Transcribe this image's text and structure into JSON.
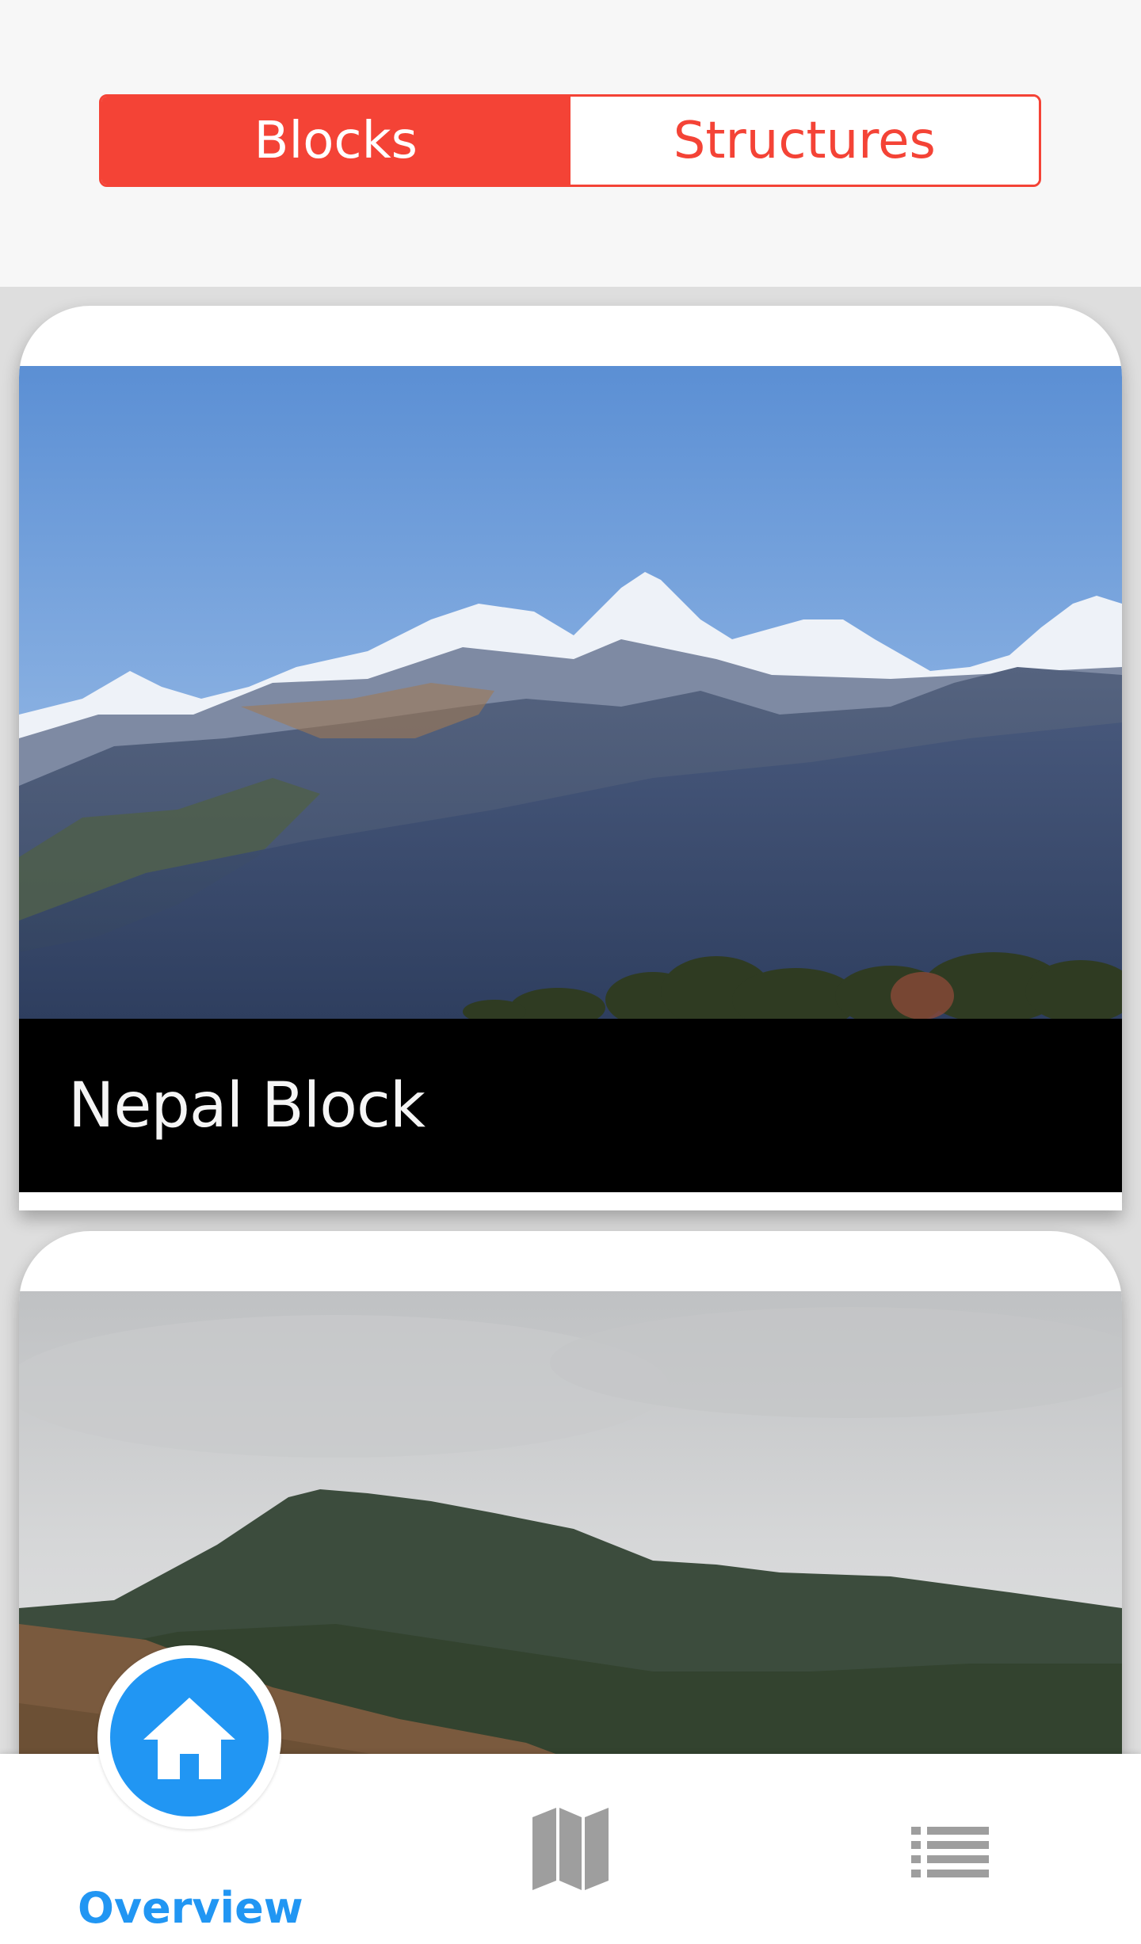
{
  "header": {
    "tabs": [
      {
        "label": "Blocks",
        "active": true
      },
      {
        "label": "Structures",
        "active": false
      }
    ],
    "accent_color": "#f44336"
  },
  "cards": [
    {
      "title": "Nepal Block",
      "image": "snow-capped-mountain-range-photo"
    },
    {
      "title": "",
      "image": "green-hill-cloudy-sky-photo"
    }
  ],
  "bottom_nav": {
    "items": [
      {
        "label": "Overview",
        "icon": "home-icon",
        "active": true
      },
      {
        "label": "",
        "icon": "map-icon",
        "active": false
      },
      {
        "label": "",
        "icon": "list-icon",
        "active": false
      }
    ],
    "active_color": "#2196f3",
    "inactive_color": "#9e9e9e"
  }
}
